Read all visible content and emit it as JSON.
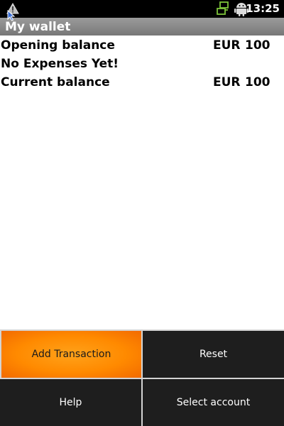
{
  "status_bar": {
    "time": "13:25",
    "icons": [
      "warning-icon",
      "cursor-icon",
      "sync-icon",
      "android-icon"
    ]
  },
  "title_bar": {
    "title": "My wallet"
  },
  "summary": {
    "opening": {
      "label": "Opening balance",
      "currency": "EUR",
      "amount": "100"
    },
    "expenses_message": "No Expenses Yet!",
    "current": {
      "label": "Current balance",
      "currency": "EUR",
      "amount": "100"
    }
  },
  "menu": {
    "add_transaction": "Add Transaction",
    "reset": "Reset",
    "help": "Help",
    "select_account": "Select account"
  },
  "colors": {
    "status_bar": "#000000",
    "title_bar": "#8a8a8a",
    "menu_bg": "#1e1e1e",
    "menu_highlight": "#ff8a00",
    "sync_icon": "#7cc43a"
  }
}
